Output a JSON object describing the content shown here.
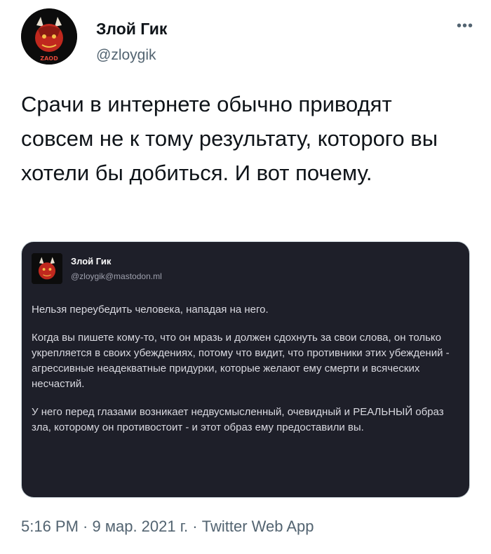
{
  "author": {
    "name": "Злой Гик",
    "handle": "@zloygik",
    "avatar_text": "ZAOD"
  },
  "tweet": {
    "text": "Срачи в интернете обычно приводят совсем не к тому результату, которого вы хотели бы добиться. И вот почему."
  },
  "embedded": {
    "name": "Злой Гик",
    "handle": "@zloygik@mastodon.ml",
    "paragraphs": [
      "Нельзя переубедить человека, нападая на него.",
      "Когда вы пишете кому-то, что он мразь и должен сдохнуть за свои слова, он только укрепляется в своих убеждениях, потому что видит, что противники этих убеждений - агрессивные неадекватные придурки, которые желают ему смерти и всяческих несчастий.",
      "У него перед глазами возникает недвусмысленный, очевидный и РЕАЛЬНЫЙ образ зла, которому он противостоит - и этот образ ему предоставили вы."
    ]
  },
  "meta": {
    "time": "5:16 PM",
    "separator": " · ",
    "date": "9 мар. 2021 г.",
    "source": "Twitter Web App"
  }
}
